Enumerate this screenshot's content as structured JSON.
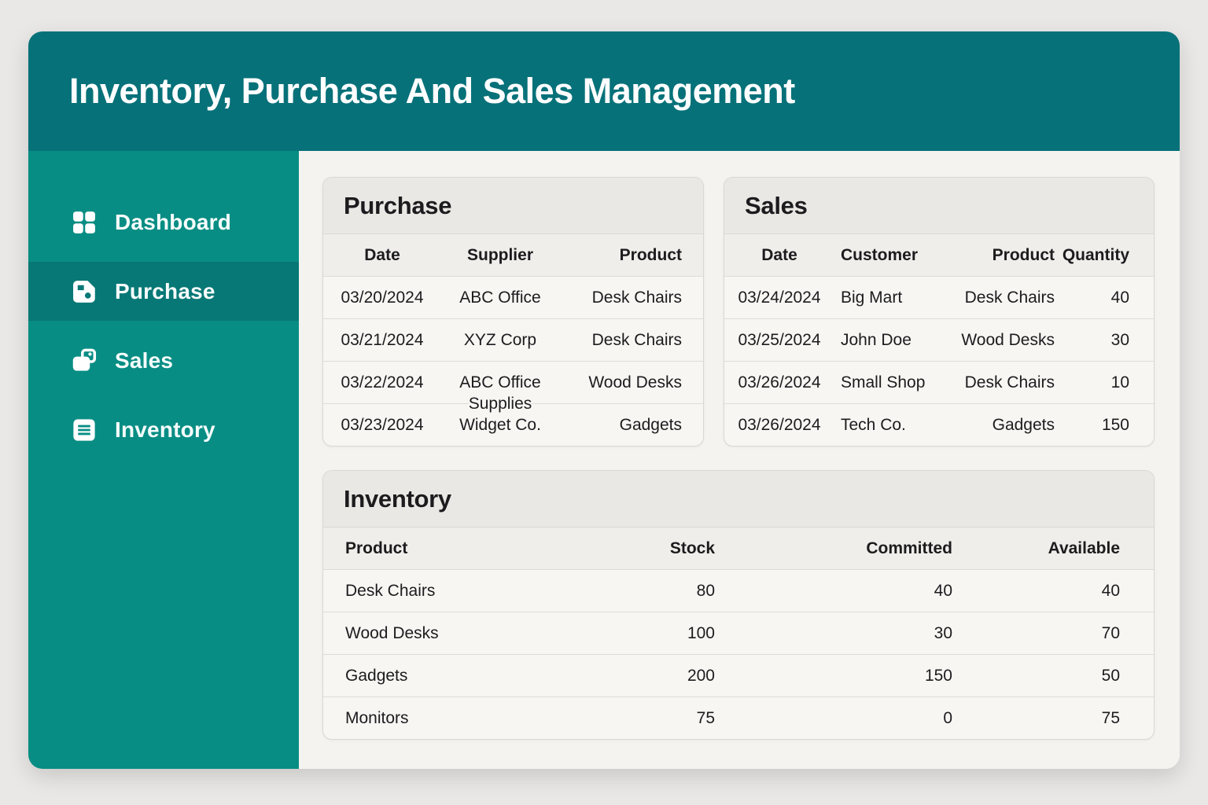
{
  "app": {
    "title": "Inventory, Purchase And Sales Management"
  },
  "colors": {
    "teal-header": "#077179",
    "teal-sidebar": "#088d84",
    "teal-active": "#077876",
    "page-bg": "#e9e8e6",
    "card-bg": "#f7f6f3"
  },
  "sidebar": {
    "items": [
      {
        "label": "Dashboard",
        "icon": "dashboard-grid-icon",
        "active": false
      },
      {
        "label": "Purchase",
        "icon": "purchase-icon",
        "active": true
      },
      {
        "label": "Sales",
        "icon": "sales-icon",
        "active": false
      },
      {
        "label": "Inventory",
        "icon": "inventory-icon",
        "active": false
      }
    ]
  },
  "purchase_table": {
    "title": "Purchase",
    "columns": [
      "Date",
      "Supplier",
      "Product"
    ],
    "rows": [
      [
        "03/20/2024",
        "ABC Office",
        "Desk Chairs"
      ],
      [
        "03/21/2024",
        "XYZ Corp",
        "Desk Chairs"
      ],
      [
        "03/22/2024",
        "ABC Office Supplies",
        "Wood Desks"
      ],
      [
        "03/23/2024",
        "Widget Co.",
        "Gadgets"
      ]
    ]
  },
  "sales_table": {
    "title": "Sales",
    "columns": [
      "Date",
      "Customer",
      "Product",
      "Quantity"
    ],
    "rows": [
      [
        "03/24/2024",
        "Big Mart",
        "Desk Chairs",
        "40"
      ],
      [
        "03/25/2024",
        "John Doe",
        "Wood Desks",
        "30"
      ],
      [
        "03/26/2024",
        "Small Shop",
        "Desk Chairs",
        "10"
      ],
      [
        "03/26/2024",
        "Tech Co.",
        "Gadgets",
        "150"
      ]
    ]
  },
  "inventory_table": {
    "title": "Inventory",
    "columns": [
      "Product",
      "Stock",
      "Committed",
      "Available"
    ],
    "rows": [
      [
        "Desk Chairs",
        "80",
        "40",
        "40"
      ],
      [
        "Wood Desks",
        "100",
        "30",
        "70"
      ],
      [
        "Gadgets",
        "200",
        "150",
        "50"
      ],
      [
        "Monitors",
        "75",
        "0",
        "75"
      ]
    ]
  }
}
